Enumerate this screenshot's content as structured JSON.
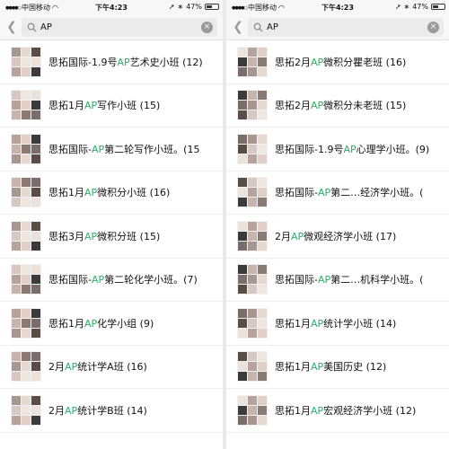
{
  "status": {
    "carrier": "中国移动",
    "time": "下午4:23",
    "battery": "47%",
    "battery_level": 0.47
  },
  "search": {
    "query": "AP",
    "placeholder": "搜索",
    "back_icon": "chevron-left-icon",
    "search_icon": "magnifier-icon",
    "clear_icon": "clear-icon"
  },
  "colors": {
    "highlight": "#2aae67",
    "search_bg": "#ebebeb"
  },
  "left_list": [
    {
      "pre": "思拓国际-1.9号",
      "hl": "AP",
      "post": "艺术史小班 (12)"
    },
    {
      "pre": "思拓1月",
      "hl": "AP",
      "post": "写作小班 (15)"
    },
    {
      "pre": "思拓国际-",
      "hl": "AP",
      "post": "第二轮写作小班。(15"
    },
    {
      "pre": "思拓1月",
      "hl": "AP",
      "post": "微积分小班 (16)"
    },
    {
      "pre": "思拓3月",
      "hl": "AP",
      "post": "微积分班 (15)"
    },
    {
      "pre": "思拓国际-",
      "hl": "AP",
      "post": "第二轮化学小班。(7)"
    },
    {
      "pre": "思拓1月",
      "hl": "AP",
      "post": "化学小组 (9)"
    },
    {
      "pre": "2月",
      "hl": "AP",
      "post": "统计学A班 (16)"
    },
    {
      "pre": "2月",
      "hl": "AP",
      "post": "统计学B班 (14)"
    }
  ],
  "right_list": [
    {
      "pre": "思拓2月",
      "hl": "AP",
      "post": "微积分瞿老班 (16)"
    },
    {
      "pre": "思拓2月",
      "hl": "AP",
      "post": "微积分未老班 (15)"
    },
    {
      "pre": "思拓国际-1.9号",
      "hl": "AP",
      "post": "心理学小班。(9)"
    },
    {
      "pre": "思拓国际-",
      "hl": "AP",
      "post": "第二…经济学小班。("
    },
    {
      "pre": "2月",
      "hl": "AP",
      "post": "微观经济学小班 (17)"
    },
    {
      "pre": "思拓国际-",
      "hl": "AP",
      "post": "第二…机科学小班。("
    },
    {
      "pre": "思拓1月",
      "hl": "AP",
      "post": "统计学小班 (14)"
    },
    {
      "pre": "思拓1月",
      "hl": "AP",
      "post": "美国历史 (12)"
    },
    {
      "pre": "思拓1月",
      "hl": "AP",
      "post": "宏观经济学小班 (12)"
    }
  ]
}
